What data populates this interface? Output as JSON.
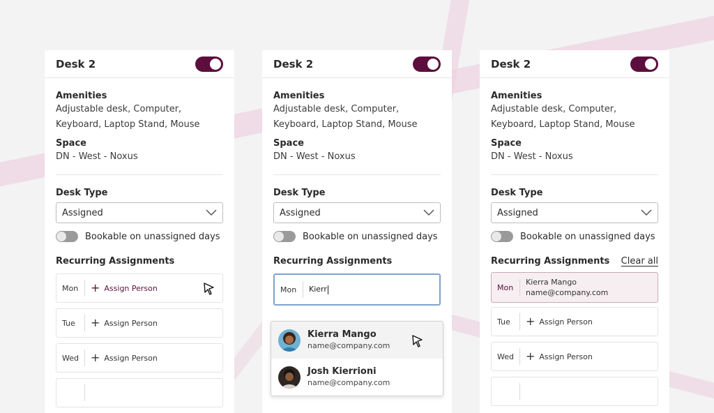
{
  "panels": [
    {
      "title": "Desk 2",
      "amenities_label": "Amenities",
      "amenities_line1": "Adjustable desk, Computer,",
      "amenities_line2": "Keyboard, Laptop Stand, Mouse",
      "space_label": "Space",
      "space_value": "DN - West - Noxus",
      "desk_type_label": "Desk Type",
      "desk_type_value": "Assigned",
      "bookable_label": "Bookable on unassigned days",
      "recurring_label": "Recurring Assignments",
      "rows": [
        {
          "day": "Mon",
          "action": "Assign Person"
        },
        {
          "day": "Tue",
          "action": "Assign Person"
        },
        {
          "day": "Wed",
          "action": "Assign Person"
        }
      ]
    },
    {
      "title": "Desk 2",
      "amenities_label": "Amenities",
      "amenities_line1": "Adjustable desk, Computer,",
      "amenities_line2": "Keyboard, Laptop Stand, Mouse",
      "space_label": "Space",
      "space_value": "DN - West - Noxus",
      "desk_type_label": "Desk Type",
      "desk_type_value": "Assigned",
      "bookable_label": "Bookable on unassigned days",
      "recurring_label": "Recurring Assignments",
      "search": {
        "day": "Mon",
        "value": "Kierr"
      },
      "suggestions": [
        {
          "name": "Kierra Mango",
          "email": "name@company.com"
        },
        {
          "name": "Josh Kierrioni",
          "email": "name@company.com"
        }
      ]
    },
    {
      "title": "Desk 2",
      "amenities_label": "Amenities",
      "amenities_line1": "Adjustable desk, Computer,",
      "amenities_line2": "Keyboard, Laptop Stand, Mouse",
      "space_label": "Space",
      "space_value": "DN - West - Noxus",
      "desk_type_label": "Desk Type",
      "desk_type_value": "Assigned",
      "bookable_label": "Bookable on unassigned days",
      "recurring_label": "Recurring Assignments",
      "clear_all": "Clear all",
      "assigned": {
        "day": "Mon",
        "name": "Kierra Mango",
        "email": "name@company.com"
      },
      "rows": [
        {
          "day": "Tue",
          "action": "Assign Person"
        },
        {
          "day": "Wed",
          "action": "Assign Person"
        }
      ]
    }
  ],
  "colors": {
    "accent": "#5c0f3c",
    "focus_border": "#7ea3cf",
    "assigned_bg": "#f6eef1",
    "background": "#f3f3f3",
    "stroke_pink": "#e9c7d9"
  },
  "toggles": {
    "header_enabled": true,
    "bookable_enabled": false
  }
}
